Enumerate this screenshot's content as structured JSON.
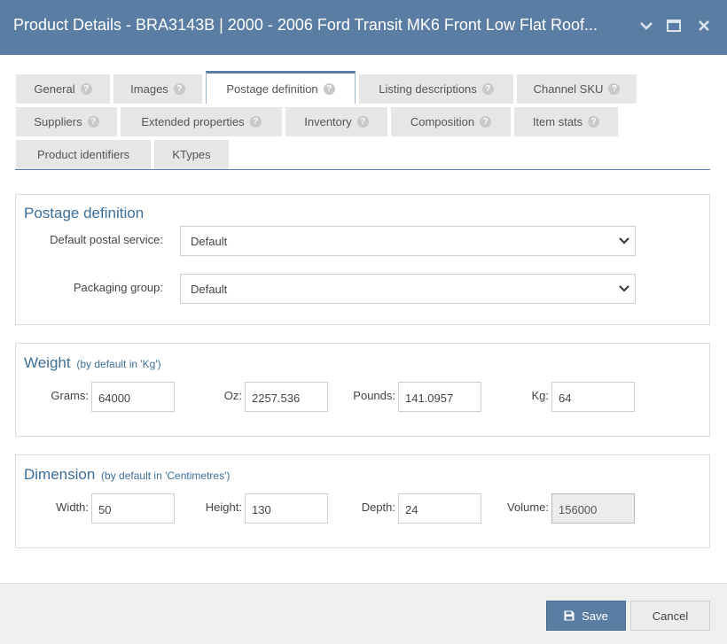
{
  "window": {
    "title": "Product Details - BRA3143B | 2000 - 2006 Ford Transit MK6 Front Low Flat Roof..."
  },
  "tabs": [
    {
      "label": "General",
      "help": true
    },
    {
      "label": "Images",
      "help": true
    },
    {
      "label": "Postage definition",
      "help": true,
      "active": true
    },
    {
      "label": "Listing descriptions",
      "help": true
    },
    {
      "label": "Channel SKU",
      "help": true
    },
    {
      "label": "Suppliers",
      "help": true
    },
    {
      "label": "Extended properties",
      "help": true
    },
    {
      "label": "Inventory",
      "help": true
    },
    {
      "label": "Composition",
      "help": true
    },
    {
      "label": "Item stats",
      "help": true
    },
    {
      "label": "Product identifiers",
      "help": false
    },
    {
      "label": "KTypes",
      "help": false
    }
  ],
  "postage": {
    "title": "Postage definition",
    "postal_service_label": "Default postal service:",
    "postal_service_value": "Default",
    "packaging_label": "Packaging group:",
    "packaging_value": "Default"
  },
  "weight": {
    "title": "Weight",
    "subtitle": "(by default in 'Kg')",
    "grams_label": "Grams:",
    "grams_value": "64000",
    "oz_label": "Oz:",
    "oz_value": "2257.536",
    "pounds_label": "Pounds:",
    "pounds_value": "141.0957",
    "kg_label": "Kg:",
    "kg_value": "64"
  },
  "dimension": {
    "title": "Dimension",
    "subtitle": "(by default in 'Centimetres')",
    "width_label": "Width:",
    "width_value": "50",
    "height_label": "Height:",
    "height_value": "130",
    "depth_label": "Depth:",
    "depth_value": "24",
    "volume_label": "Volume:",
    "volume_value": "156000"
  },
  "footer": {
    "save_label": "Save",
    "cancel_label": "Cancel"
  },
  "colors": {
    "header": "#5a7ea3",
    "accent_text": "#3d6e9a",
    "tab_bg": "#e6e6e6"
  }
}
